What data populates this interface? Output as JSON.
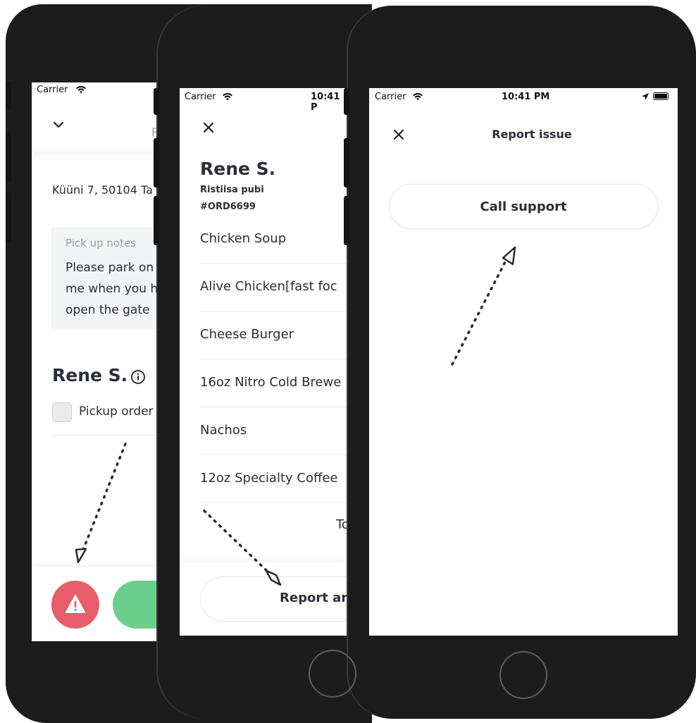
{
  "screen1": {
    "carrier": "Carrier",
    "header_partial": "R",
    "address": "Küüni 7, 50104 Ta",
    "notes_label": "Pick up notes",
    "notes_lines": [
      "Please park on",
      "me when you h",
      "open the gate"
    ],
    "customer_name": "Rene S.",
    "pickup_label": "Pickup order"
  },
  "screen2": {
    "carrier": "Carrier",
    "time": "10:41 P",
    "customer_name": "Rene S.",
    "restaurant": "Ristiisa pubi",
    "order_id": "#ORD6699",
    "items": [
      "Chicken Soup",
      "Alive Chicken[fast foc",
      "Cheese Burger",
      "16oz Nitro Cold Brewe",
      "Nachos",
      "12oz Specialty Coffee"
    ],
    "total_partial": "To",
    "report_button": "Report an"
  },
  "screen3": {
    "carrier": "Carrier",
    "time": "10:41 PM",
    "title": "Report issue",
    "call_support": "Call support"
  },
  "colors": {
    "alert_red": "#e85d6a",
    "confirm_green": "#6bcf8c",
    "notes_bg": "#f3f4f6",
    "phone_body": "#1c1c1c"
  }
}
